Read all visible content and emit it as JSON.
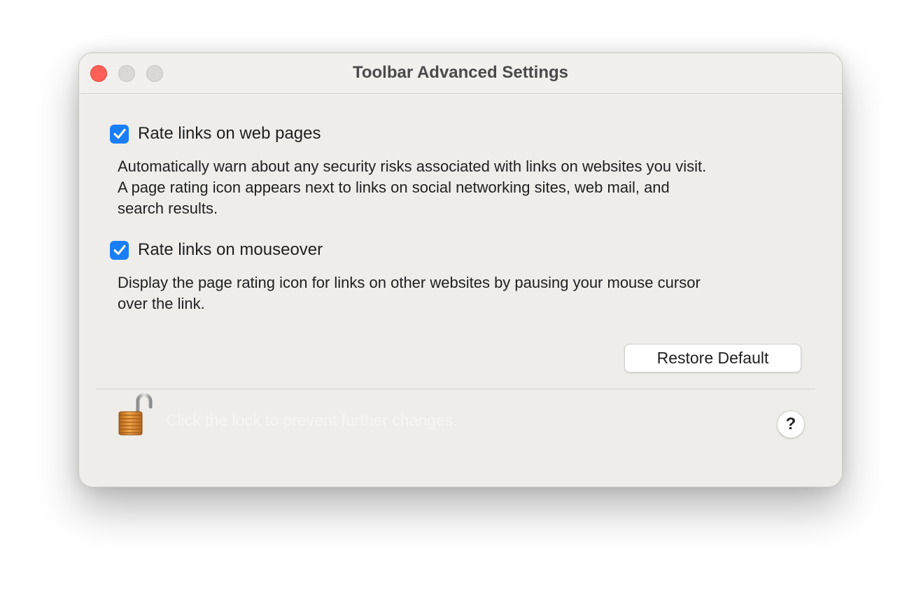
{
  "window": {
    "title": "Toolbar Advanced Settings"
  },
  "options": [
    {
      "label": "Rate links on web pages",
      "checked": true,
      "description": [
        "Automatically warn about any security risks associated with links on websites you visit.",
        "A page rating icon appears next to links on social networking sites, web mail, and",
        "search results."
      ]
    },
    {
      "label": "Rate links on mouseover",
      "checked": true,
      "description": [
        "Display the page rating icon for links on other websites by pausing your mouse cursor",
        "over the link."
      ]
    }
  ],
  "restore_button": "Restore Default",
  "footer": {
    "lock_text": "Click the lock to prevent further changes.",
    "help_label": "?"
  },
  "colors": {
    "checkbox_accent": "#1a7ff5",
    "close_button": "#fe5f57",
    "window_bg": "#eeedea"
  }
}
